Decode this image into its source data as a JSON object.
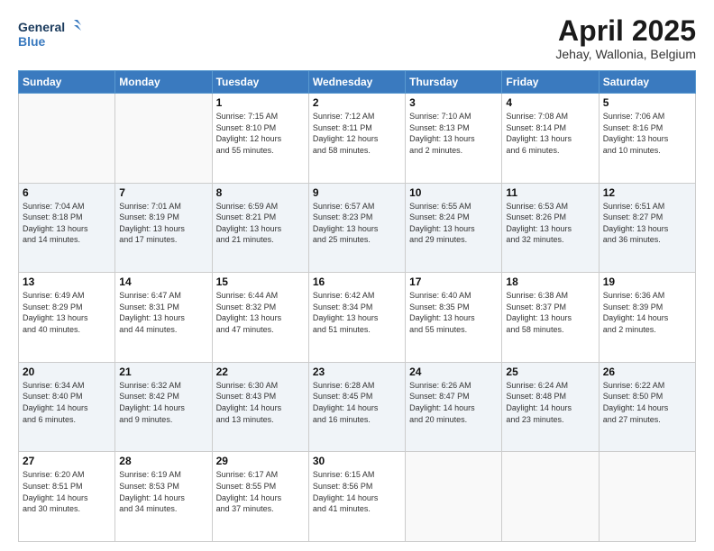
{
  "logo": {
    "line1": "General",
    "line2": "Blue"
  },
  "title": "April 2025",
  "location": "Jehay, Wallonia, Belgium",
  "days_header": [
    "Sunday",
    "Monday",
    "Tuesday",
    "Wednesday",
    "Thursday",
    "Friday",
    "Saturday"
  ],
  "weeks": [
    [
      {
        "day": "",
        "info": ""
      },
      {
        "day": "",
        "info": ""
      },
      {
        "day": "1",
        "info": "Sunrise: 7:15 AM\nSunset: 8:10 PM\nDaylight: 12 hours\nand 55 minutes."
      },
      {
        "day": "2",
        "info": "Sunrise: 7:12 AM\nSunset: 8:11 PM\nDaylight: 12 hours\nand 58 minutes."
      },
      {
        "day": "3",
        "info": "Sunrise: 7:10 AM\nSunset: 8:13 PM\nDaylight: 13 hours\nand 2 minutes."
      },
      {
        "day": "4",
        "info": "Sunrise: 7:08 AM\nSunset: 8:14 PM\nDaylight: 13 hours\nand 6 minutes."
      },
      {
        "day": "5",
        "info": "Sunrise: 7:06 AM\nSunset: 8:16 PM\nDaylight: 13 hours\nand 10 minutes."
      }
    ],
    [
      {
        "day": "6",
        "info": "Sunrise: 7:04 AM\nSunset: 8:18 PM\nDaylight: 13 hours\nand 14 minutes."
      },
      {
        "day": "7",
        "info": "Sunrise: 7:01 AM\nSunset: 8:19 PM\nDaylight: 13 hours\nand 17 minutes."
      },
      {
        "day": "8",
        "info": "Sunrise: 6:59 AM\nSunset: 8:21 PM\nDaylight: 13 hours\nand 21 minutes."
      },
      {
        "day": "9",
        "info": "Sunrise: 6:57 AM\nSunset: 8:23 PM\nDaylight: 13 hours\nand 25 minutes."
      },
      {
        "day": "10",
        "info": "Sunrise: 6:55 AM\nSunset: 8:24 PM\nDaylight: 13 hours\nand 29 minutes."
      },
      {
        "day": "11",
        "info": "Sunrise: 6:53 AM\nSunset: 8:26 PM\nDaylight: 13 hours\nand 32 minutes."
      },
      {
        "day": "12",
        "info": "Sunrise: 6:51 AM\nSunset: 8:27 PM\nDaylight: 13 hours\nand 36 minutes."
      }
    ],
    [
      {
        "day": "13",
        "info": "Sunrise: 6:49 AM\nSunset: 8:29 PM\nDaylight: 13 hours\nand 40 minutes."
      },
      {
        "day": "14",
        "info": "Sunrise: 6:47 AM\nSunset: 8:31 PM\nDaylight: 13 hours\nand 44 minutes."
      },
      {
        "day": "15",
        "info": "Sunrise: 6:44 AM\nSunset: 8:32 PM\nDaylight: 13 hours\nand 47 minutes."
      },
      {
        "day": "16",
        "info": "Sunrise: 6:42 AM\nSunset: 8:34 PM\nDaylight: 13 hours\nand 51 minutes."
      },
      {
        "day": "17",
        "info": "Sunrise: 6:40 AM\nSunset: 8:35 PM\nDaylight: 13 hours\nand 55 minutes."
      },
      {
        "day": "18",
        "info": "Sunrise: 6:38 AM\nSunset: 8:37 PM\nDaylight: 13 hours\nand 58 minutes."
      },
      {
        "day": "19",
        "info": "Sunrise: 6:36 AM\nSunset: 8:39 PM\nDaylight: 14 hours\nand 2 minutes."
      }
    ],
    [
      {
        "day": "20",
        "info": "Sunrise: 6:34 AM\nSunset: 8:40 PM\nDaylight: 14 hours\nand 6 minutes."
      },
      {
        "day": "21",
        "info": "Sunrise: 6:32 AM\nSunset: 8:42 PM\nDaylight: 14 hours\nand 9 minutes."
      },
      {
        "day": "22",
        "info": "Sunrise: 6:30 AM\nSunset: 8:43 PM\nDaylight: 14 hours\nand 13 minutes."
      },
      {
        "day": "23",
        "info": "Sunrise: 6:28 AM\nSunset: 8:45 PM\nDaylight: 14 hours\nand 16 minutes."
      },
      {
        "day": "24",
        "info": "Sunrise: 6:26 AM\nSunset: 8:47 PM\nDaylight: 14 hours\nand 20 minutes."
      },
      {
        "day": "25",
        "info": "Sunrise: 6:24 AM\nSunset: 8:48 PM\nDaylight: 14 hours\nand 23 minutes."
      },
      {
        "day": "26",
        "info": "Sunrise: 6:22 AM\nSunset: 8:50 PM\nDaylight: 14 hours\nand 27 minutes."
      }
    ],
    [
      {
        "day": "27",
        "info": "Sunrise: 6:20 AM\nSunset: 8:51 PM\nDaylight: 14 hours\nand 30 minutes."
      },
      {
        "day": "28",
        "info": "Sunrise: 6:19 AM\nSunset: 8:53 PM\nDaylight: 14 hours\nand 34 minutes."
      },
      {
        "day": "29",
        "info": "Sunrise: 6:17 AM\nSunset: 8:55 PM\nDaylight: 14 hours\nand 37 minutes."
      },
      {
        "day": "30",
        "info": "Sunrise: 6:15 AM\nSunset: 8:56 PM\nDaylight: 14 hours\nand 41 minutes."
      },
      {
        "day": "",
        "info": ""
      },
      {
        "day": "",
        "info": ""
      },
      {
        "day": "",
        "info": ""
      }
    ]
  ]
}
